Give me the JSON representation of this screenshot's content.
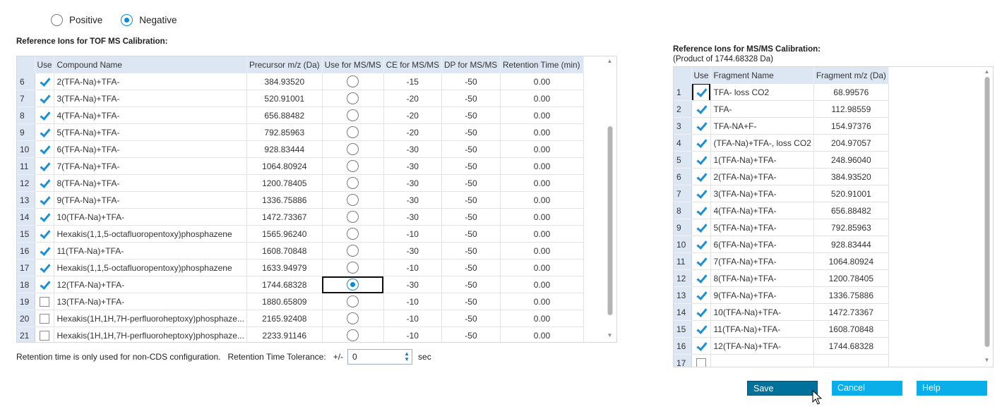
{
  "polarity": {
    "options": [
      {
        "label": "Positive",
        "selected": false
      },
      {
        "label": "Negative",
        "selected": true
      }
    ]
  },
  "tof": {
    "title": "Reference Ions for TOF MS Calibration:",
    "headers": [
      "",
      "Use",
      "Compound Name",
      "Precursor m/z (Da)",
      "Use for MS/MS",
      "CE for MS/MS",
      "DP for MS/MS",
      "Retention Time (min)"
    ],
    "rows": [
      {
        "n": "6",
        "use": true,
        "name": "2(TFA-Na)+TFA-",
        "mz": "384.93520",
        "msms": false,
        "ce": "-15",
        "dp": "-50",
        "rt": "0.00"
      },
      {
        "n": "7",
        "use": true,
        "name": "3(TFA-Na)+TFA-",
        "mz": "520.91001",
        "msms": false,
        "ce": "-20",
        "dp": "-50",
        "rt": "0.00"
      },
      {
        "n": "8",
        "use": true,
        "name": "4(TFA-Na)+TFA-",
        "mz": "656.88482",
        "msms": false,
        "ce": "-20",
        "dp": "-50",
        "rt": "0.00"
      },
      {
        "n": "9",
        "use": true,
        "name": "5(TFA-Na)+TFA-",
        "mz": "792.85963",
        "msms": false,
        "ce": "-20",
        "dp": "-50",
        "rt": "0.00"
      },
      {
        "n": "10",
        "use": true,
        "name": "6(TFA-Na)+TFA-",
        "mz": "928.83444",
        "msms": false,
        "ce": "-30",
        "dp": "-50",
        "rt": "0.00"
      },
      {
        "n": "11",
        "use": true,
        "name": "7(TFA-Na)+TFA-",
        "mz": "1064.80924",
        "msms": false,
        "ce": "-30",
        "dp": "-50",
        "rt": "0.00"
      },
      {
        "n": "12",
        "use": true,
        "name": "8(TFA-Na)+TFA-",
        "mz": "1200.78405",
        "msms": false,
        "ce": "-30",
        "dp": "-50",
        "rt": "0.00"
      },
      {
        "n": "13",
        "use": true,
        "name": "9(TFA-Na)+TFA-",
        "mz": "1336.75886",
        "msms": false,
        "ce": "-30",
        "dp": "-50",
        "rt": "0.00"
      },
      {
        "n": "14",
        "use": true,
        "name": "10(TFA-Na)+TFA-",
        "mz": "1472.73367",
        "msms": false,
        "ce": "-30",
        "dp": "-50",
        "rt": "0.00"
      },
      {
        "n": "15",
        "use": true,
        "name": "Hexakis(1,1,5-octafluoropentoxy)phosphazene",
        "mz": "1565.96240",
        "msms": false,
        "ce": "-10",
        "dp": "-50",
        "rt": "0.00"
      },
      {
        "n": "16",
        "use": true,
        "name": "11(TFA-Na)+TFA-",
        "mz": "1608.70848",
        "msms": false,
        "ce": "-30",
        "dp": "-50",
        "rt": "0.00"
      },
      {
        "n": "17",
        "use": true,
        "name": "Hexakis(1,1,5-octafluoropentoxy)phosphazene",
        "mz": "1633.94979",
        "msms": false,
        "ce": "-10",
        "dp": "-50",
        "rt": "0.00"
      },
      {
        "n": "18",
        "use": true,
        "name": "12(TFA-Na)+TFA-",
        "mz": "1744.68328",
        "msms": true,
        "ce": "-30",
        "dp": "-50",
        "rt": "0.00"
      },
      {
        "n": "19",
        "use": false,
        "name": "13(TFA-Na)+TFA-",
        "mz": "1880.65809",
        "msms": false,
        "ce": "-10",
        "dp": "-50",
        "rt": "0.00"
      },
      {
        "n": "20",
        "use": false,
        "name": "Hexakis(1H,1H,7H-perfluoroheptoxy)phosphaze...",
        "mz": "2165.92408",
        "msms": false,
        "ce": "-10",
        "dp": "-50",
        "rt": "0.00"
      },
      {
        "n": "21",
        "use": false,
        "name": "Hexakis(1H,1H,7H-perfluoroheptoxy)phosphaze...",
        "mz": "2233.91146",
        "msms": false,
        "ce": "-10",
        "dp": "-50",
        "rt": "0.00"
      }
    ]
  },
  "footer": {
    "note": "Retention time is only used for non-CDS configuration.",
    "tolerance_label": "Retention Time Tolerance:",
    "plus_minus": "+/-",
    "tolerance_value": "0",
    "unit": "sec"
  },
  "msms": {
    "title": "Reference Ions for MS/MS Calibration:",
    "subtitle": "(Product of 1744.68328 Da)",
    "headers": [
      "",
      "Use",
      "Fragment Name",
      "Fragment m/z (Da)"
    ],
    "rows": [
      {
        "n": "1",
        "use": true,
        "name": "TFA- loss CO2",
        "mz": "68.99576"
      },
      {
        "n": "2",
        "use": true,
        "name": "TFA-",
        "mz": "112.98559"
      },
      {
        "n": "3",
        "use": true,
        "name": "TFA-NA+F-",
        "mz": "154.97376"
      },
      {
        "n": "4",
        "use": true,
        "name": "(TFA-Na)+TFA-, loss CO2",
        "mz": "204.97057"
      },
      {
        "n": "5",
        "use": true,
        "name": "1(TFA-Na)+TFA-",
        "mz": "248.96040"
      },
      {
        "n": "6",
        "use": true,
        "name": "2(TFA-Na)+TFA-",
        "mz": "384.93520"
      },
      {
        "n": "7",
        "use": true,
        "name": "3(TFA-Na)+TFA-",
        "mz": "520.91001"
      },
      {
        "n": "8",
        "use": true,
        "name": "4(TFA-Na)+TFA-",
        "mz": "656.88482"
      },
      {
        "n": "9",
        "use": true,
        "name": "5(TFA-Na)+TFA-",
        "mz": "792.85963"
      },
      {
        "n": "10",
        "use": true,
        "name": "6(TFA-Na)+TFA-",
        "mz": "928.83444"
      },
      {
        "n": "11",
        "use": true,
        "name": "7(TFA-Na)+TFA-",
        "mz": "1064.80924"
      },
      {
        "n": "12",
        "use": true,
        "name": "8(TFA-Na)+TFA-",
        "mz": "1200.78405"
      },
      {
        "n": "13",
        "use": true,
        "name": "9(TFA-Na)+TFA-",
        "mz": "1336.75886"
      },
      {
        "n": "14",
        "use": true,
        "name": "10(TFA-Na)+TFA-",
        "mz": "1472.73367"
      },
      {
        "n": "15",
        "use": true,
        "name": "11(TFA-Na)+TFA-",
        "mz": "1608.70848"
      },
      {
        "n": "16",
        "use": true,
        "name": "12(TFA-Na)+TFA-",
        "mz": "1744.68328"
      },
      {
        "n": "17",
        "use": false,
        "name": "",
        "mz": ""
      }
    ]
  },
  "buttons": {
    "save": "Save",
    "cancel": "Cancel",
    "help": "Help"
  },
  "colors": {
    "accent": "#0b8ad8",
    "header_bg": "#dde7f3",
    "save_bg": "#00719a",
    "button_bg": "#0aaee8"
  }
}
